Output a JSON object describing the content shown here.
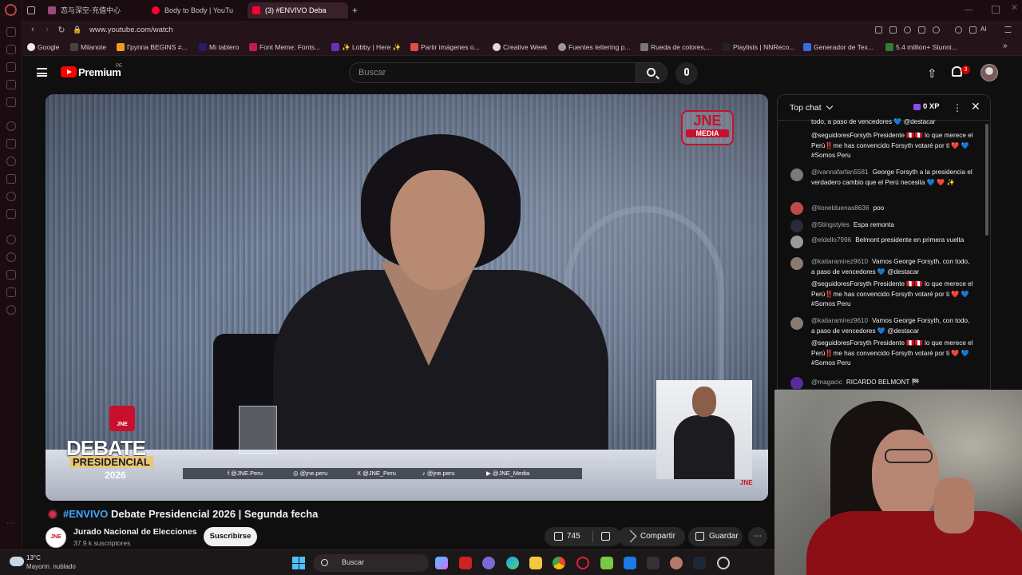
{
  "browser": {
    "tabs": [
      {
        "label": "恋与深空-充值中心",
        "color": "#9a4a7a"
      },
      {
        "label": "Body to Body | YouTu",
        "color": "#ff0033"
      },
      {
        "label": "(3) #ENVIVO Deba",
        "color": "#ff0033"
      }
    ],
    "url": "www.youtube.com/watch",
    "ai_label": "AI",
    "bookmarks": [
      {
        "label": "Google",
        "color": "#eee"
      },
      {
        "label": "Milanote",
        "color": "#333"
      },
      {
        "label": "Группа BEGINS ≠...",
        "color": "#f29a1f"
      },
      {
        "label": "Mi tablero",
        "color": "#2a1a6a"
      },
      {
        "label": "Font Meme: Fonts...",
        "color": "#c2185b"
      },
      {
        "label": "✨ Lobby | Here ✨",
        "color": "#6b2fbf"
      },
      {
        "label": "Partir imágenes o...",
        "color": "#e24c4c"
      },
      {
        "label": "Creative Week",
        "color": "#ddd"
      },
      {
        "label": "Fuentes lettering p...",
        "color": "#999"
      },
      {
        "label": "Rueda de colores,...",
        "color": "#777"
      },
      {
        "label": "Playlists | NNReco...",
        "color": "#222"
      },
      {
        "label": "Generador de Tex...",
        "color": "#3a6ae0"
      },
      {
        "label": "5.4 million+ Stunni...",
        "color": "#2e7d32"
      }
    ]
  },
  "youtube": {
    "brand": "Premium",
    "country": "PE",
    "search_placeholder": "Buscar",
    "notif_count": "3"
  },
  "video": {
    "badge_top": "JNE",
    "badge_bottom": "MEDIA",
    "debate_icon": "JNE",
    "debate_word": "DEBATE",
    "debate_sub": "PRESIDENCIAL",
    "debate_year": "2026",
    "socials": [
      "f  @JNE.Peru",
      "◎  @jne.peru",
      "X  @JNE_Peru",
      "♪  @jne.peru",
      "▶  @JNE_Media"
    ],
    "corner_logo": "JNE",
    "title_tag": "#ENVIVO",
    "title_rest": "Debate Presidencial 2026 | Segunda fecha",
    "channel": "Jurado Nacional de Elecciones",
    "channel_avatar": "JNE",
    "subs": "37.9 k suscriptores",
    "subscribe": "Suscribirse",
    "likes": "745",
    "share": "Compartir",
    "save": "Guardar"
  },
  "chat": {
    "title": "Top chat",
    "xp": "0 XP",
    "messages": [
      {
        "author": "",
        "text": "todo, a paso de vencedores 💙 @destacar"
      },
      {
        "author": "",
        "text": "@seguidoresForsyth Presidente 🇵🇪🇵🇪 lo que merece el Perú‼️me has convencido Forsyth votaré por ti ❤️ 💙 #Somos Peru"
      },
      {
        "author": "@ivannafarfan5581",
        "text": "George Forsyth a la presidencia el verdadero cambio que el Perú necesita 💙 ❤️ ✨"
      },
      {
        "author": "@lionelduenas8636",
        "text": "poo"
      },
      {
        "author": "@Stingstyles",
        "text": "Espa remonta"
      },
      {
        "author": "@eldello7996",
        "text": "Belmont presidente en primera vuelta"
      },
      {
        "author": "@katiaramirez9610",
        "text": "Vamos George Forsyth, con todo, a paso de vencedores 💙 @destacar"
      },
      {
        "author": "",
        "text": "@seguidoresForsyth Presidente 🇵🇪🇵🇪 lo que merece el Perú‼️me has convencido Forsyth votaré por ti ❤️ 💙 #Somos Peru"
      },
      {
        "author": "@katiaramirez9610",
        "text": "Vamos George Forsyth, con todo, a paso de vencedores 💙 @destacar"
      },
      {
        "author": "",
        "text": "@seguidoresForsyth Presidente 🇵🇪🇵🇪 lo que merece el Perú‼️me has convencido Forsyth votaré por ti ❤️ 💙 #Somos Peru"
      },
      {
        "author": "@magacic",
        "text": "RICARDO BELMONT 🏁"
      }
    ]
  },
  "taskbar": {
    "temp": "13°C",
    "weather": "Mayorm. nublado",
    "search": "Buscar"
  }
}
